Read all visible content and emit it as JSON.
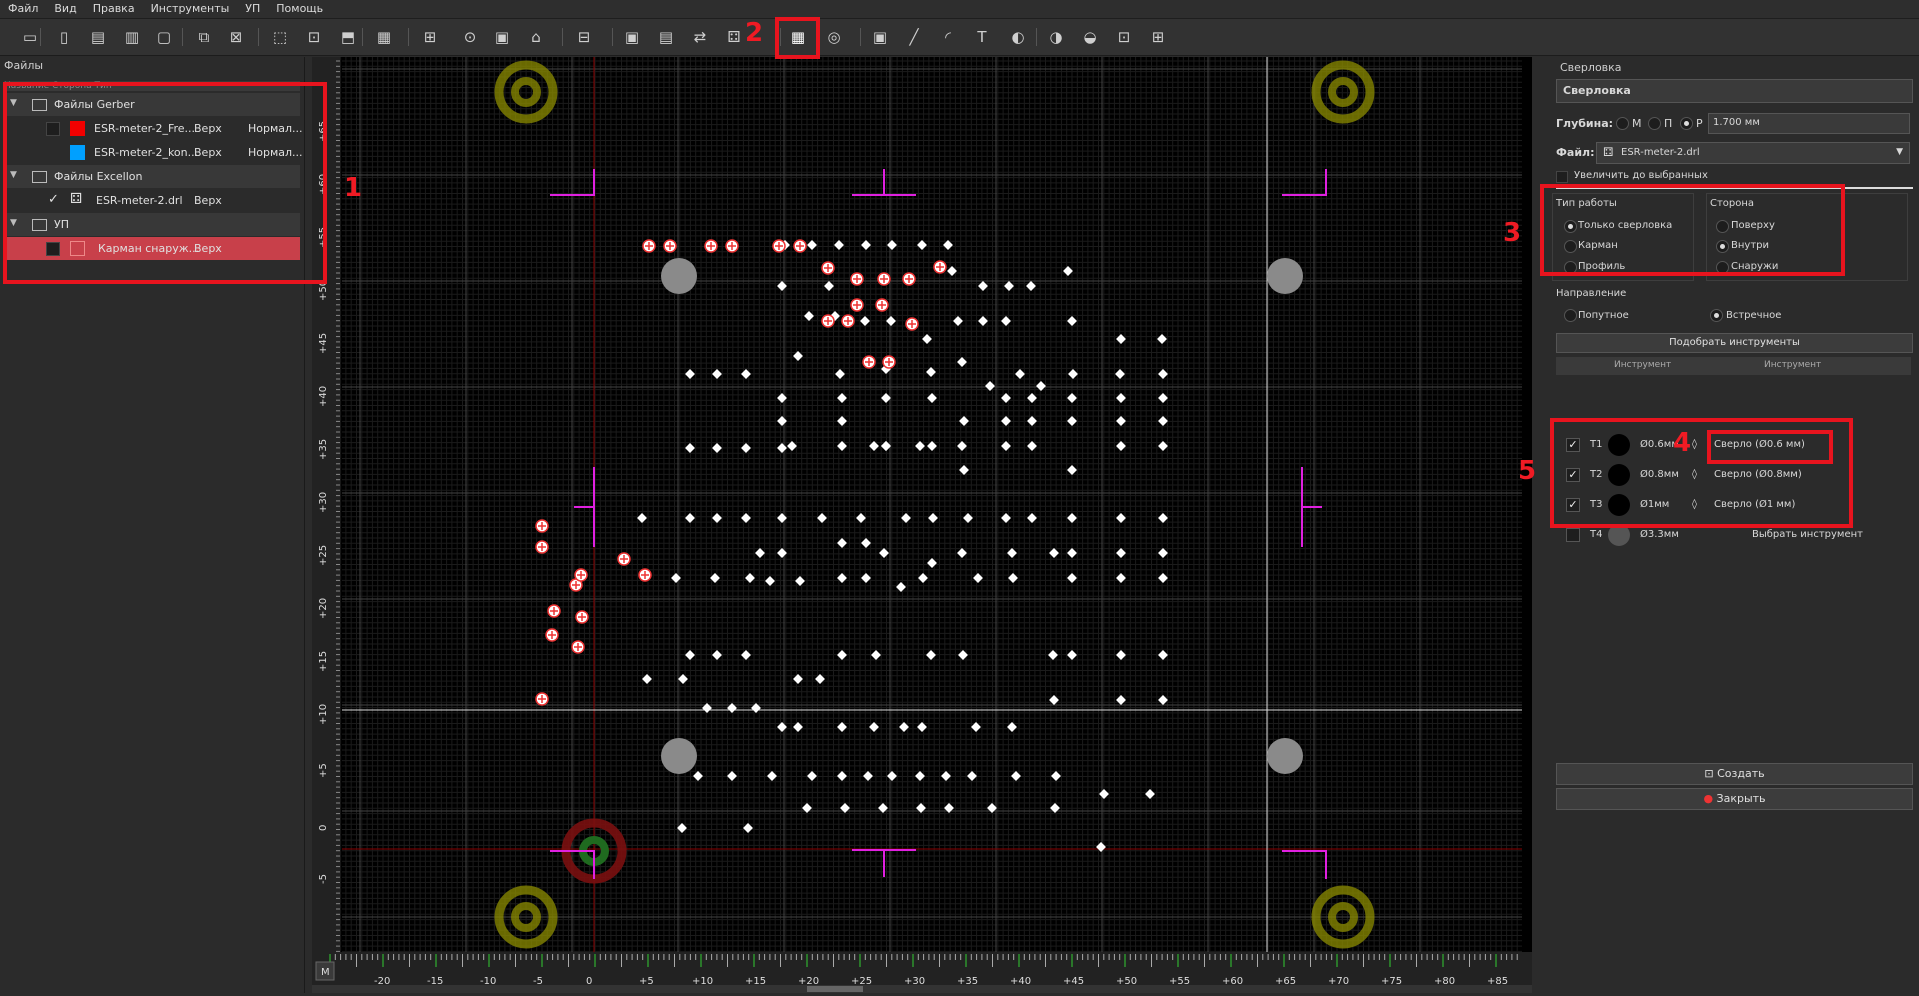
{
  "menu": [
    "Файл",
    "Вид",
    "Правка",
    "Инструменты",
    "УП",
    "Помощь"
  ],
  "toolbar_icons": [
    "new-icon",
    "open-icon",
    "save-icon",
    "save-as-icon",
    "close-file-icon",
    "copy-icon",
    "delete-icon",
    "fit-icon",
    "zoom-icon",
    "select-icon",
    "layers-icon",
    "grid-icon",
    "run-icon",
    "gcode-icon",
    "board-icon",
    "home-icon",
    "board-outline-icon",
    "mirror-icon",
    "drill-profile-icon",
    "path-icon",
    "drilling-icon",
    "pocket-icon",
    "circle-icon",
    "rect-icon",
    "line-icon",
    "arc-icon",
    "text-icon",
    "union-icon",
    "diff-icon",
    "intersect-icon",
    "group-icon"
  ],
  "files_panel": {
    "title": "Файлы",
    "header": "Название     Сторона     Тип",
    "groups": [
      {
        "label": "Файлы Gerber",
        "items": [
          {
            "name": "ESR-meter-2_Fre...",
            "side": "Верх",
            "type": "Нормал...",
            "color": "#f20000",
            "checked": false
          },
          {
            "name": "ESR-meter-2_kon...",
            "side": "Верх",
            "type": "Нормал...",
            "color": "#00a0ff",
            "checked": false
          }
        ]
      },
      {
        "label": "Файлы Excellon",
        "items": [
          {
            "name": "ESR-meter-2.drl",
            "side": "Верх",
            "checked": true
          }
        ]
      },
      {
        "label": "УП",
        "items": [
          {
            "name": "Карман снаруж...",
            "side": "Верх",
            "checked": false
          }
        ]
      }
    ]
  },
  "ruler": {
    "x_labels": [
      "-20",
      "-15",
      "-10",
      "-5",
      "0",
      "+5",
      "+10",
      "+15",
      "+20",
      "+25",
      "+30",
      "+35",
      "+40",
      "+45",
      "+50",
      "+55",
      "+60",
      "+65",
      "+70",
      "+75",
      "+80",
      "+85"
    ],
    "y_labels": [
      "+65",
      "+60",
      "+55",
      "+50",
      "+45",
      "+40",
      "+35",
      "+30",
      "+25",
      "+20",
      "+15",
      "+10",
      "+5",
      "0",
      "-5"
    ],
    "corner": "M"
  },
  "drill_panel": {
    "title": "Сверловка",
    "name_value": "Сверловка",
    "depth_label": "Глубина:",
    "depth_opts": [
      "М",
      "П",
      "Р"
    ],
    "depth_value": "1.700 мм",
    "file_label": "Файл:",
    "file_value": "ESR-meter-2.drl",
    "increase_label": "Увеличить до выбранных",
    "work_type_title": "Тип работы",
    "work_types": [
      "Только сверловка",
      "Карман",
      "Профиль"
    ],
    "side_title": "Сторона",
    "sides": [
      "Поверху",
      "Внутри",
      "Снаружи"
    ],
    "direction_title": "Направление",
    "directions": [
      "Попутное",
      "Встречное"
    ],
    "pick_tools_button": "Подобрать инструменты",
    "table_headers": [
      "Инструмент",
      "Инструмент"
    ],
    "tools": [
      {
        "id": "T1",
        "diameter": "Ø0.6мм",
        "tool": "Сверло (Ø0.6 мм)",
        "checked": true
      },
      {
        "id": "T2",
        "diameter": "Ø0.8мм",
        "tool": "Сверло (Ø0.8мм)",
        "checked": true
      },
      {
        "id": "T3",
        "diameter": "Ø1мм",
        "tool": "Сверло (Ø1 мм)",
        "checked": true
      },
      {
        "id": "T4",
        "diameter": "Ø3.3мм",
        "tool": "Выбрать инструмент",
        "checked": false
      }
    ],
    "create_button": "Создать",
    "close_button": "Закрыть"
  },
  "annotations": [
    "1",
    "2",
    "3",
    "4",
    "5"
  ]
}
